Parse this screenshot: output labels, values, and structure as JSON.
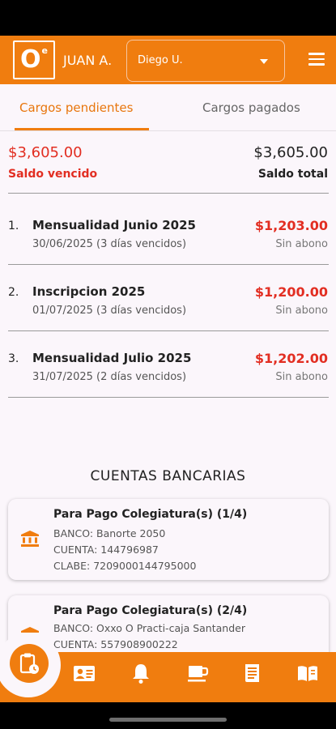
{
  "header": {
    "logo_text": "O",
    "logo_sup": "e",
    "user_name": "JUAN A.",
    "student_select_value": "Diego U.",
    "menu_icon": "hamburger-menu-icon"
  },
  "tabs": [
    {
      "label": "Cargos pendientes",
      "active": true
    },
    {
      "label": "Cargos pagados",
      "active": false
    }
  ],
  "summary": {
    "overdue_amount": "$3,605.00",
    "overdue_label": "Saldo vencido",
    "total_amount": "$3,605.00",
    "total_label": "Saldo total"
  },
  "charges": [
    {
      "index": "1.",
      "title": "Mensualidad Junio 2025",
      "amount": "$1,203.00",
      "date": "30/06/2025 (3 días vencidos)",
      "status": "Sin abono"
    },
    {
      "index": "2.",
      "title": "Inscripcion 2025",
      "amount": "$1,200.00",
      "date": "01/07/2025 (3 días vencidos)",
      "status": "Sin abono"
    },
    {
      "index": "3.",
      "title": "Mensualidad Julio 2025",
      "amount": "$1,202.00",
      "date": "31/07/2025 (2 días vencidos)",
      "status": "Sin abono"
    }
  ],
  "bank_section": {
    "title": "CUENTAS BANCARIAS",
    "cards": [
      {
        "title": "Para Pago Colegiatura(s) (1/4)",
        "bank": "BANCO: Banorte 2050",
        "account": "CUENTA: 144796987",
        "clabe": "CLABE: 7209000144795000"
      },
      {
        "title": "Para Pago Colegiatura(s) (2/4)",
        "bank": "BANCO: Oxxo O Practi-caja Santander",
        "account": "CUENTA: 557908900222",
        "clabe": ""
      }
    ]
  },
  "bottom_nav": [
    "payments-clipboard-icon",
    "contact-card-icon",
    "bell-icon",
    "coffee-cup-icon",
    "newspaper-icon",
    "open-book-icon"
  ],
  "colors": {
    "primary": "#f07d0f",
    "danger": "#e22e22",
    "background": "#fbf6fb"
  }
}
